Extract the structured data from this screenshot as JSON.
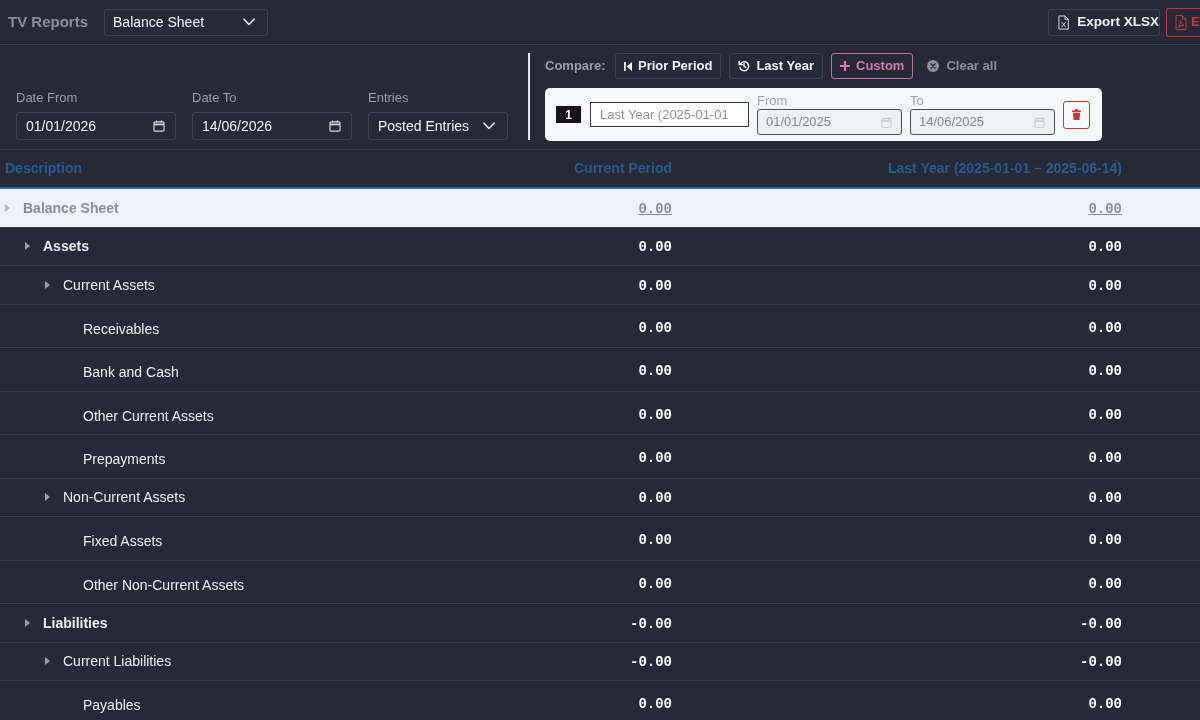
{
  "header": {
    "app_title": "TV Reports",
    "report_select": {
      "value": "Balance Sheet"
    },
    "actions": [
      {
        "kind": "xlsx",
        "label": "Export XLSX"
      },
      {
        "kind": "pdf",
        "label": "E"
      }
    ]
  },
  "filters": [
    {
      "kind": "date",
      "label": "Date From",
      "value": "01/01/2026"
    },
    {
      "kind": "date",
      "label": "Date To",
      "value": "14/06/2026"
    },
    {
      "kind": "select",
      "label": "Entries",
      "value": "Posted Entries"
    }
  ],
  "compare": {
    "label": "Compare:",
    "options": [
      {
        "kind": "prior",
        "label": "Prior Period",
        "selected": false
      },
      {
        "kind": "history",
        "label": "Last Year",
        "selected": false
      },
      {
        "kind": "custom",
        "label": "Custom",
        "selected": true
      }
    ],
    "clear_label": "Clear all",
    "periods": [
      {
        "number": "1",
        "name_placeholder": "Last Year (2025-01-01",
        "from": {
          "label": "From",
          "value": "01/01/2025",
          "disabled": true
        },
        "to": {
          "label": "To",
          "value": "14/06/2025",
          "disabled": true
        }
      }
    ]
  },
  "table": {
    "columns": [
      "Description",
      "Current Period",
      "Last Year (2025-01-01 – 2025-06-14)"
    ],
    "rows": [
      {
        "label": "Balance Sheet",
        "values": [
          "0.00",
          "0.00"
        ],
        "selected": true,
        "children": [
          {
            "label": "Assets",
            "values": [
              "0.00",
              "0.00"
            ],
            "selected": false,
            "children": [
              {
                "label": "Current Assets",
                "values": [
                  "0.00",
                  "0.00"
                ],
                "selected": false,
                "children": [
                  {
                    "label": "Receivables",
                    "values": [
                      "0.00",
                      "0.00"
                    ],
                    "selected": false
                  },
                  {
                    "label": "Bank and Cash",
                    "values": [
                      "0.00",
                      "0.00"
                    ],
                    "selected": false
                  },
                  {
                    "label": "Other Current Assets",
                    "values": [
                      "0.00",
                      "0.00"
                    ],
                    "selected": false
                  },
                  {
                    "label": "Prepayments",
                    "values": [
                      "0.00",
                      "0.00"
                    ],
                    "selected": false
                  }
                ]
              },
              {
                "label": "Non-Current Assets",
                "values": [
                  "0.00",
                  "0.00"
                ],
                "selected": false,
                "children": [
                  {
                    "label": "Fixed Assets",
                    "values": [
                      "0.00",
                      "0.00"
                    ],
                    "selected": false
                  },
                  {
                    "label": "Other Non-Current Assets",
                    "values": [
                      "0.00",
                      "0.00"
                    ],
                    "selected": false
                  }
                ]
              }
            ]
          },
          {
            "label": "Liabilities",
            "values": [
              "-0.00",
              "-0.00"
            ],
            "selected": false,
            "children": [
              {
                "label": "Current Liabilities",
                "values": [
                  "-0.00",
                  "-0.00"
                ],
                "selected": false,
                "children": [
                  {
                    "label": "Payables",
                    "values": [
                      "0.00",
                      "0.00"
                    ],
                    "selected": false
                  }
                ]
              }
            ]
          }
        ]
      }
    ]
  }
}
